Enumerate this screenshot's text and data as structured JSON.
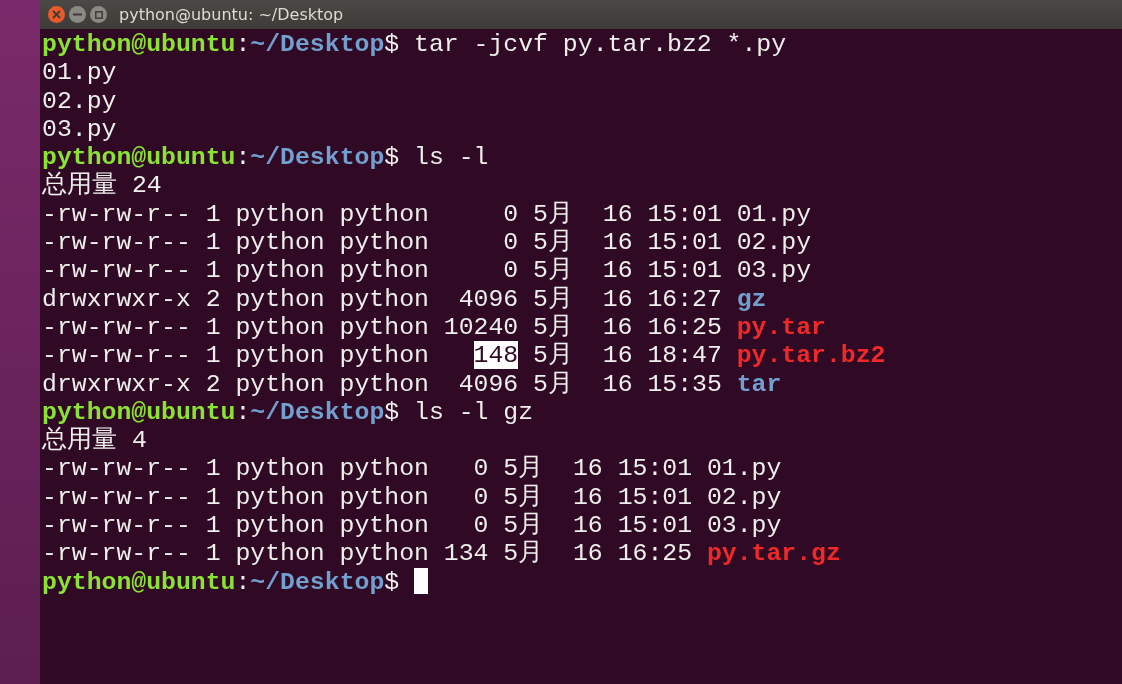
{
  "window": {
    "title": "python@ubuntu: ~/Desktop"
  },
  "lines": [
    {
      "kind": "prompt",
      "user": "python@ubuntu",
      "sep": ":",
      "path": "~/Desktop",
      "symbol": "$",
      "command": "tar -jcvf py.tar.bz2 *.py"
    },
    {
      "kind": "output",
      "text": "01.py"
    },
    {
      "kind": "output",
      "text": "02.py"
    },
    {
      "kind": "output",
      "text": "03.py"
    },
    {
      "kind": "prompt",
      "user": "python@ubuntu",
      "sep": ":",
      "path": "~/Desktop",
      "symbol": "$",
      "command": "ls -l"
    },
    {
      "kind": "output",
      "text": "总用量 24"
    },
    {
      "kind": "listing",
      "meta": "-rw-rw-r-- 1 python python",
      "size": "    0",
      "selected": false,
      "date": "5月  16 15:01",
      "name": "01.py",
      "color": "#eeeeec"
    },
    {
      "kind": "listing",
      "meta": "-rw-rw-r-- 1 python python",
      "size": "    0",
      "selected": false,
      "date": "5月  16 15:01",
      "name": "02.py",
      "color": "#eeeeec"
    },
    {
      "kind": "listing",
      "meta": "-rw-rw-r-- 1 python python",
      "size": "    0",
      "selected": false,
      "date": "5月  16 15:01",
      "name": "03.py",
      "color": "#eeeeec"
    },
    {
      "kind": "listing",
      "meta": "drwxrwxr-x 2 python python",
      "size": " 4096",
      "selected": false,
      "date": "5月  16 16:27",
      "name": "gz",
      "color": "#729fcf"
    },
    {
      "kind": "listing",
      "meta": "-rw-rw-r-- 1 python python",
      "size": "10240",
      "selected": false,
      "date": "5月  16 16:25",
      "name": "py.tar",
      "color": "#ef2929"
    },
    {
      "kind": "listing",
      "meta": "-rw-rw-r-- 1 python python",
      "size": "  148",
      "selected": true,
      "date": "5月  16 18:47",
      "name": "py.tar.bz2",
      "color": "#ef2929"
    },
    {
      "kind": "listing",
      "meta": "drwxrwxr-x 2 python python",
      "size": " 4096",
      "selected": false,
      "date": "5月  16 15:35",
      "name": "tar",
      "color": "#729fcf"
    },
    {
      "kind": "prompt",
      "user": "python@ubuntu",
      "sep": ":",
      "path": "~/Desktop",
      "symbol": "$",
      "command": "ls -l gz"
    },
    {
      "kind": "output",
      "text": "总用量 4"
    },
    {
      "kind": "listing",
      "meta": "-rw-rw-r-- 1 python python",
      "size": "  0",
      "selected": false,
      "date": "5月  16 15:01",
      "name": "01.py",
      "color": "#eeeeec"
    },
    {
      "kind": "listing",
      "meta": "-rw-rw-r-- 1 python python",
      "size": "  0",
      "selected": false,
      "date": "5月  16 15:01",
      "name": "02.py",
      "color": "#eeeeec"
    },
    {
      "kind": "listing",
      "meta": "-rw-rw-r-- 1 python python",
      "size": "  0",
      "selected": false,
      "date": "5月  16 15:01",
      "name": "03.py",
      "color": "#eeeeec"
    },
    {
      "kind": "listing",
      "meta": "-rw-rw-r-- 1 python python",
      "size": "134",
      "selected": false,
      "date": "5月  16 16:25",
      "name": "py.tar.gz",
      "color": "#ef2929"
    },
    {
      "kind": "prompt",
      "user": "python@ubuntu",
      "sep": ":",
      "path": "~/Desktop",
      "symbol": "$",
      "cursor": true
    }
  ]
}
